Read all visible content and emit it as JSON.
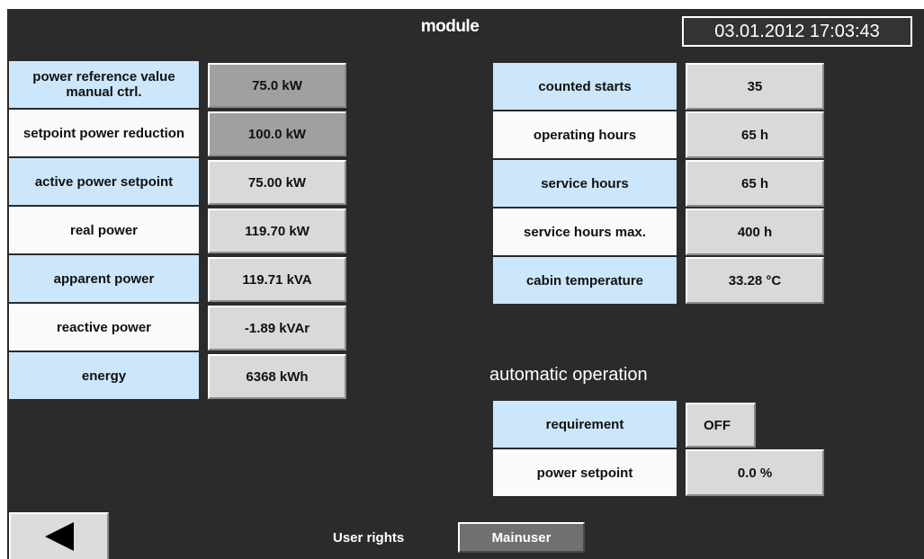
{
  "header": {
    "title": "module",
    "datetime": "03.01.2012 17:03:43"
  },
  "left_params": [
    {
      "label": "power reference value manual ctrl.",
      "value": "75.0 kW"
    },
    {
      "label": "setpoint power reduction",
      "value": "100.0 kW"
    },
    {
      "label": "active power setpoint",
      "value": "75.00 kW"
    },
    {
      "label": "real power",
      "value": "119.70 kW"
    },
    {
      "label": "apparent power",
      "value": "119.71 kVA"
    },
    {
      "label": "reactive power",
      "value": "-1.89 kVAr"
    },
    {
      "label": "energy",
      "value": "6368 kWh"
    }
  ],
  "right_params": [
    {
      "label": "counted starts",
      "value": "35"
    },
    {
      "label": "operating hours",
      "value": "65 h"
    },
    {
      "label": "service hours",
      "value": "65 h"
    },
    {
      "label": "service hours max.",
      "value": "400 h"
    },
    {
      "label": "cabin temperature",
      "value": "33.28 °C"
    }
  ],
  "automatic": {
    "title": "automatic operation",
    "requirement_label": "requirement",
    "requirement_value": "OFF",
    "power_setpoint_label": "power setpoint",
    "power_setpoint_value": "0.0 %"
  },
  "footer": {
    "back_icon": "left-arrow-icon",
    "user_rights_label": "User rights",
    "user_level": "Mainuser"
  },
  "colors": {
    "background": "#2b2b2b",
    "label_blue": "#cce6fb",
    "label_white": "#fafafa",
    "value_field": "#d9d9d9",
    "value_field_editable": "#a0a0a0"
  }
}
